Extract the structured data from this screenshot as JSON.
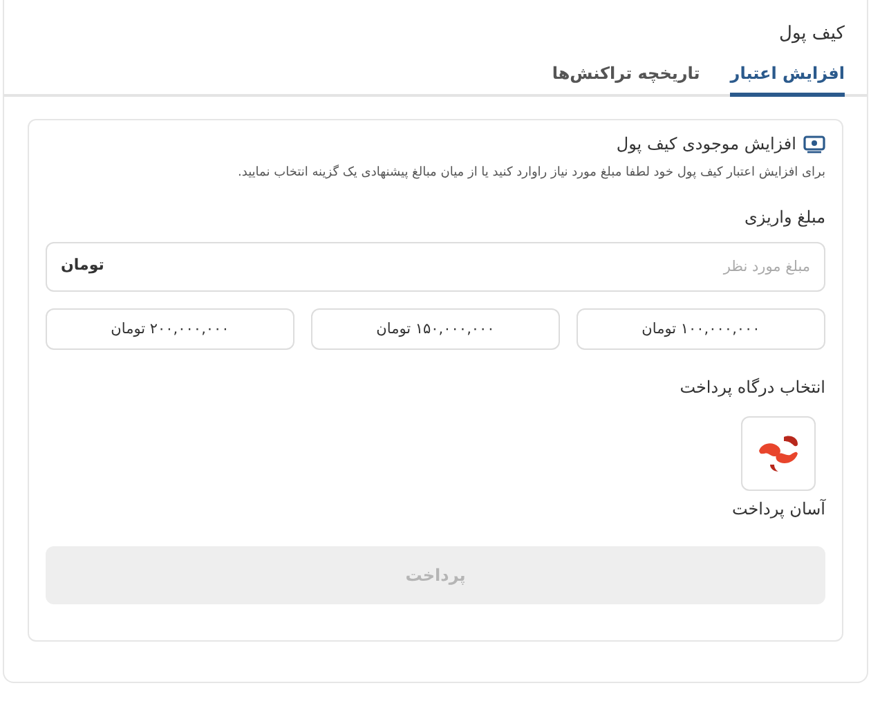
{
  "page": {
    "title": "کیف پول"
  },
  "tabs": [
    {
      "label": "افزایش اعتبار",
      "selected": true
    },
    {
      "label": "تاریخچه تراکنش‌ها",
      "selected": false
    }
  ],
  "card": {
    "title": "افزایش موجودی کیف پول",
    "description": "برای افزایش اعتبار کیف پول خود لطفا مبلغ مورد نیاز راوارد کنید یا از میان مبالغ پیشنهادی یک گزینه انتخاب نمایید.",
    "amount_label": "مبلغ واریزی",
    "amount_field": {
      "placeholder": "مبلغ مورد نظر",
      "unit": "تومان"
    },
    "suggested_amounts": [
      "۱۰۰,۰۰۰,۰۰۰ تومان",
      "۱۵۰,۰۰۰,۰۰۰ تومان",
      "۲۰۰,۰۰۰,۰۰۰ تومان"
    ],
    "gateway_label": "انتخاب درگاه پرداخت",
    "gateways": [
      {
        "name": "آسان پرداخت"
      }
    ],
    "pay_button": {
      "label": "پرداخت",
      "disabled": true
    }
  }
}
